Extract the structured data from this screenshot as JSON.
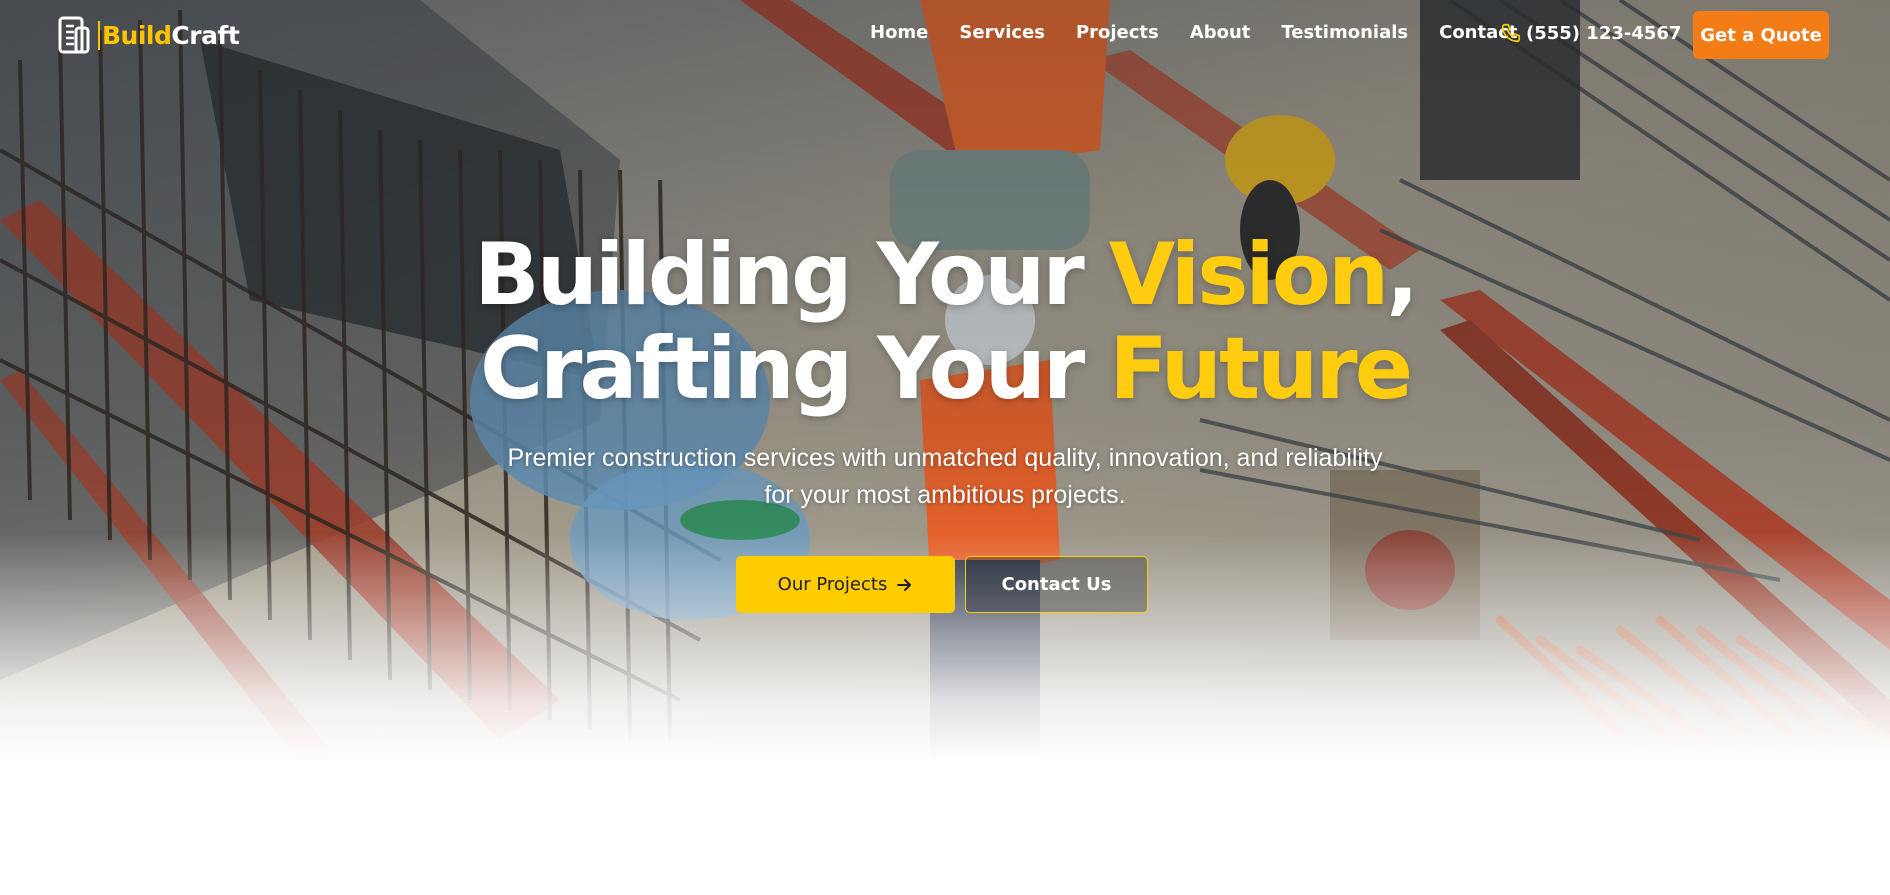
{
  "brand": {
    "name_part1": "Build",
    "name_part2": "Craft",
    "icon": "building-icon"
  },
  "nav": {
    "links": [
      "Home",
      "Services",
      "Projects",
      "About",
      "Testimonials",
      "Contact"
    ],
    "phone": "(555) 123-4567",
    "phone_icon": "phone-icon",
    "cta": "Get a Quote"
  },
  "hero": {
    "line1_a": "Building Your ",
    "line1_b": "Vision",
    "line1_c": ",",
    "line2_a": "Crafting Your ",
    "line2_b": "Future",
    "subtitle": "Premier construction services with unmatched quality, innovation, and reliability for your most ambitious projects.",
    "primary_button": "Our Projects",
    "primary_button_icon": "arrow-right-icon",
    "secondary_button": "Contact Us"
  },
  "colors": {
    "accent_yellow": "#ffcc00",
    "cta_orange": "#f47c16",
    "white": "#ffffff"
  }
}
